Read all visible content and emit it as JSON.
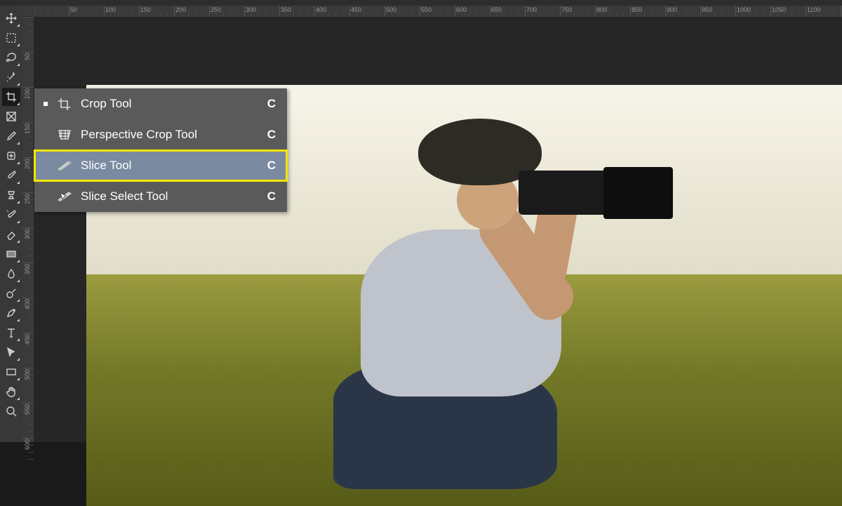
{
  "ruler": {
    "h_ticks": [
      50,
      100,
      150,
      200,
      250,
      300,
      350,
      400,
      450,
      500,
      550,
      600,
      650,
      700,
      750,
      800,
      850,
      900,
      950
    ],
    "v_ticks": [
      50,
      100,
      150,
      200,
      250,
      300,
      350,
      400,
      450,
      500
    ]
  },
  "toolbar": {
    "tools": [
      {
        "name": "move-tool",
        "fly": true
      },
      {
        "name": "marquee-tool",
        "fly": true
      },
      {
        "name": "lasso-tool",
        "fly": true
      },
      {
        "name": "magic-wand-tool",
        "fly": true
      },
      {
        "name": "crop-tool",
        "fly": true,
        "active": true
      },
      {
        "name": "frame-tool",
        "fly": false
      },
      {
        "name": "eyedropper-tool",
        "fly": true
      },
      {
        "name": "healing-brush-tool",
        "fly": true
      },
      {
        "name": "brush-tool",
        "fly": true
      },
      {
        "name": "clone-stamp-tool",
        "fly": true
      },
      {
        "name": "history-brush-tool",
        "fly": true
      },
      {
        "name": "eraser-tool",
        "fly": true
      },
      {
        "name": "gradient-tool",
        "fly": true
      },
      {
        "name": "blur-tool",
        "fly": true
      },
      {
        "name": "dodge-tool",
        "fly": true
      },
      {
        "name": "pen-tool",
        "fly": true
      },
      {
        "name": "type-tool",
        "fly": true
      },
      {
        "name": "path-selection-tool",
        "fly": true
      },
      {
        "name": "rectangle-tool",
        "fly": true
      },
      {
        "name": "hand-tool",
        "fly": true
      },
      {
        "name": "zoom-tool",
        "fly": false
      }
    ]
  },
  "flyout": {
    "items": [
      {
        "label": "Crop Tool",
        "shortcut": "C",
        "current": true,
        "icon": "crop-icon"
      },
      {
        "label": "Perspective Crop Tool",
        "shortcut": "C",
        "icon": "perspective-crop-icon"
      },
      {
        "label": "Slice Tool",
        "shortcut": "C",
        "selected": true,
        "highlight": true,
        "icon": "slice-icon"
      },
      {
        "label": "Slice Select Tool",
        "shortcut": "C",
        "icon": "slice-select-icon"
      }
    ]
  }
}
